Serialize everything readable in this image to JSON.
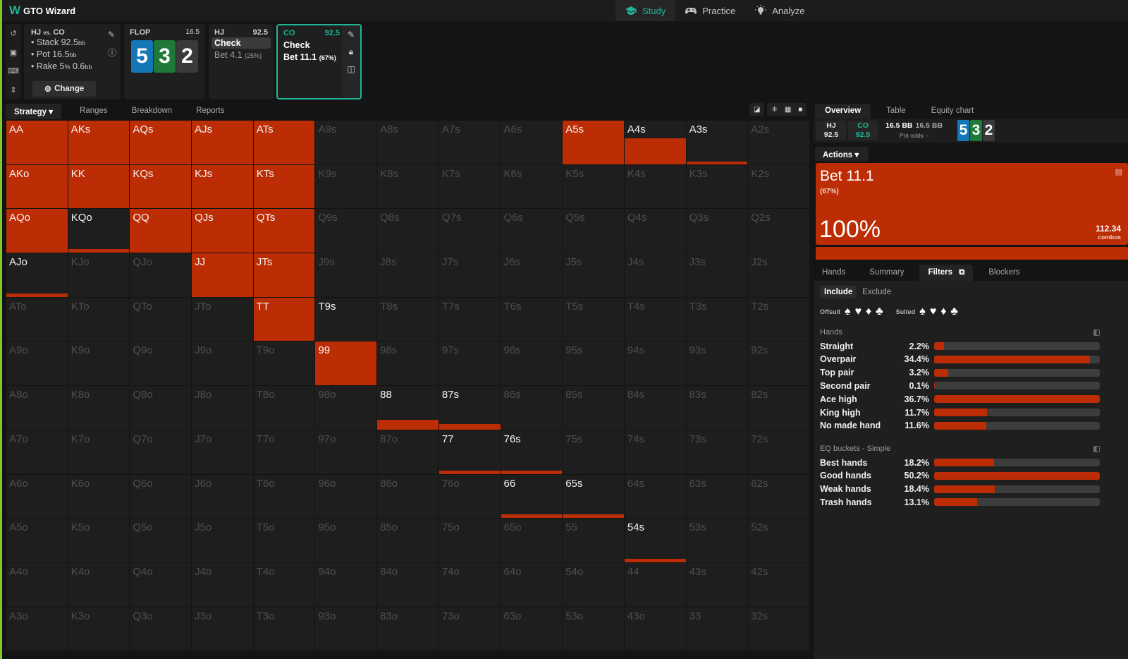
{
  "app": {
    "title": "GTO Wizard",
    "logo": "W"
  },
  "nav": [
    {
      "label": "Study",
      "icon": "graduation-cap-icon",
      "active": true
    },
    {
      "label": "Practice",
      "icon": "gamepad-icon",
      "active": false
    },
    {
      "label": "Analyze",
      "icon": "lightbulb-icon",
      "active": false
    }
  ],
  "scenario": {
    "title_a": "HJ",
    "title_vs": "vs.",
    "title_b": "CO",
    "stack_label": "Stack 92.5",
    "stack_unit": "bb",
    "pot_label": "Pot 16.5",
    "pot_unit": "bb",
    "rake_label": "Rake 5",
    "rake_pct": "%",
    "rake_amt": " 0.6",
    "rake_unit": "bb",
    "change_label": "Change"
  },
  "flop": {
    "label": "FLOP",
    "pot": "16.5",
    "cards": [
      {
        "rank": "5",
        "suit": "diamonds"
      },
      {
        "rank": "3",
        "suit": "clubs"
      },
      {
        "rank": "2",
        "suit": "spades"
      }
    ]
  },
  "hj_node": {
    "player": "HJ",
    "stack": "92.5",
    "actions": [
      {
        "label": "Check",
        "selected": true,
        "pct": ""
      },
      {
        "label": "Bet 4.1",
        "selected": false,
        "pct": "(25%)"
      }
    ]
  },
  "co_node": {
    "player": "CO",
    "stack": "92.5",
    "actions": [
      {
        "label": "Check",
        "pct": ""
      },
      {
        "label": "Bet 11.1",
        "pct": "(67%)"
      }
    ]
  },
  "tabs": [
    {
      "label": "Strategy",
      "active": true
    },
    {
      "label": "Ranges"
    },
    {
      "label": "Breakdown"
    },
    {
      "label": "Reports"
    }
  ],
  "colors": {
    "bet": "#bc2d05",
    "accent": "#1fb597",
    "cell_bg": "#1e1e1e"
  },
  "grid": {
    "ranks": [
      "A",
      "K",
      "Q",
      "J",
      "T",
      "9",
      "8",
      "7",
      "6",
      "5",
      "4",
      "3",
      "2"
    ],
    "visible_rows": 12,
    "frequencies": {
      "AA": 1,
      "AKs": 1,
      "AQs": 1,
      "AJs": 1,
      "ATs": 1,
      "A5s": 1,
      "A4s": 0.6,
      "A3s": 0.04,
      "AKo": 1,
      "KK": 1,
      "KQs": 1,
      "KJs": 1,
      "KTs": 1,
      "AQo": 1,
      "KQo": 0.08,
      "QQ": 1,
      "QJs": 1,
      "QTs": 1,
      "AJo": 0.08,
      "JJ": 1,
      "JTs": 1,
      "TT": 1,
      "T9s": 0,
      "99": 1,
      "88": 0.22,
      "87s": 0.12,
      "77": 0.08,
      "76s": 0.08,
      "66": 0.08,
      "65s": 0.08,
      "54s": 0.08
    },
    "highlighted": [
      "AA",
      "AKs",
      "AQs",
      "AJs",
      "ATs",
      "A5s",
      "A4s",
      "A3s",
      "AKo",
      "KK",
      "KQs",
      "KJs",
      "KTs",
      "AQo",
      "KQo",
      "QQ",
      "QJs",
      "QTs",
      "AJo",
      "JJ",
      "JTs",
      "TT",
      "T9s",
      "99",
      "88",
      "87s",
      "77",
      "76s",
      "66",
      "65s",
      "54s"
    ]
  },
  "right_panel": {
    "tabs": [
      {
        "label": "Overview",
        "active": true
      },
      {
        "label": "Table"
      },
      {
        "label": "Equity chart"
      }
    ],
    "hj": {
      "label": "HJ",
      "stack": "92.5"
    },
    "co": {
      "label": "CO",
      "stack": "92.5"
    },
    "pot_bb": "16.5 BB",
    "pot_bb2": "16.5 BB",
    "pot_odds": "Pot odds:  -",
    "actions_label": "Actions",
    "action": {
      "title": "Bet 11.1",
      "sub": "(67%)",
      "pct": "100%",
      "combos": "112.34",
      "combos_label": "combos",
      "frequency": 1.0
    },
    "sub_tabs": [
      {
        "label": "Hands"
      },
      {
        "label": "Summary"
      },
      {
        "label": "Filters",
        "active": true
      },
      {
        "label": "Blockers"
      }
    ],
    "include": "Include",
    "exclude": "Exclude",
    "offsuit_label": "Offsuit",
    "suited_label": "Suited",
    "suit_symbols": [
      "♠",
      "♥",
      "♦",
      "♣"
    ],
    "hands_title": "Hands",
    "hands": [
      {
        "name": "Straight",
        "value": "2.2%",
        "bar": 0.06
      },
      {
        "name": "Overpair",
        "value": "34.4%",
        "bar": 0.94
      },
      {
        "name": "Top pair",
        "value": "3.2%",
        "bar": 0.087
      },
      {
        "name": "Second pair",
        "value": "0.1%",
        "bar": 0.005
      },
      {
        "name": "Ace high",
        "value": "36.7%",
        "bar": 1.0
      },
      {
        "name": "King high",
        "value": "11.7%",
        "bar": 0.32
      },
      {
        "name": "No made hand",
        "value": "11.6%",
        "bar": 0.316
      }
    ],
    "eq_title": "EQ buckets - Simple",
    "eq": [
      {
        "name": "Best hands",
        "value": "18.2%",
        "bar": 0.363
      },
      {
        "name": "Good hands",
        "value": "50.2%",
        "bar": 1.0
      },
      {
        "name": "Weak hands",
        "value": "18.4%",
        "bar": 0.367
      },
      {
        "name": "Trash hands",
        "value": "13.1%",
        "bar": 0.261
      }
    ]
  }
}
